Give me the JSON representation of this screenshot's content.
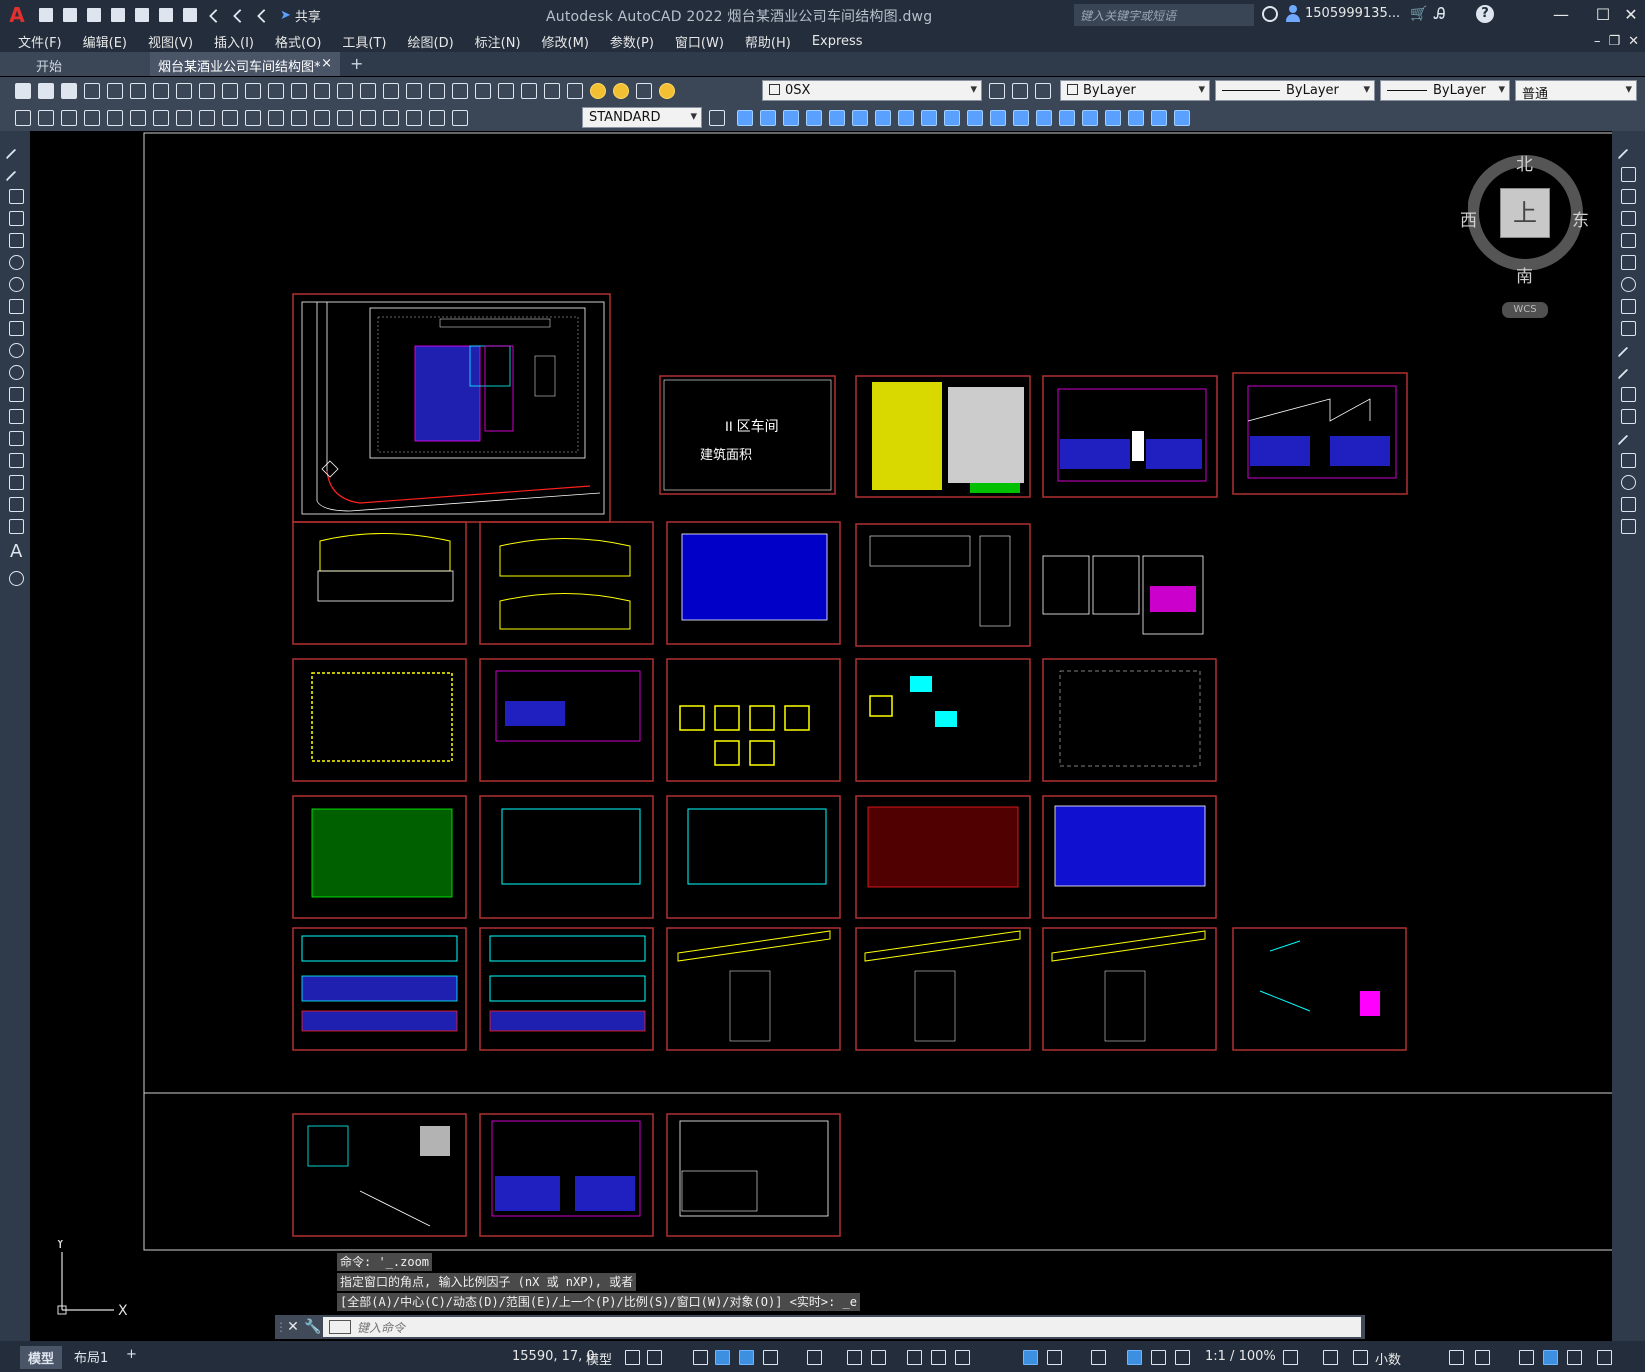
{
  "titlebar": {
    "title": "Autodesk AutoCAD 2022    烟台某酒业公司车间结构图.dwg",
    "share": "共享",
    "search_placeholder": "键入关键字或短语",
    "user": "1505999135...",
    "logo": "A"
  },
  "menu": [
    "文件(F)",
    "编辑(E)",
    "视图(V)",
    "插入(I)",
    "格式(O)",
    "工具(T)",
    "绘图(D)",
    "标注(N)",
    "修改(M)",
    "参数(P)",
    "窗口(W)",
    "帮助(H)",
    "Express"
  ],
  "tabs": {
    "start": "开始",
    "active": "烟台某酒业公司车间结构图*",
    "close": "×",
    "add": "+"
  },
  "toolbar": {
    "layer": "0SX",
    "text_style": "STANDARD",
    "color": "ByLayer",
    "linetype": "ByLayer",
    "lineweight": "ByLayer",
    "plot_style": "普通"
  },
  "canvas": {
    "sheet_title": "II 区车间",
    "sheet_subtitle": "建筑面积"
  },
  "compass": {
    "north": "北",
    "south": "南",
    "east": "东",
    "west": "西",
    "top": "上",
    "wcs": "WCS"
  },
  "ucs": {
    "y": "Y",
    "x": "X"
  },
  "command": {
    "history": [
      "命令: '_.zoom",
      "指定窗口的角点, 输入比例因子 (nX 或 nXP), 或者",
      "[全部(A)/中心(C)/动态(D)/范围(E)/上一个(P)/比例(S)/窗口(W)/对象(O)] <实时>: _e"
    ],
    "placeholder": "键入命令"
  },
  "status": {
    "model_tab": "模型",
    "layout_tab": "布局1",
    "add": "+",
    "coords": "15590, 17, 0",
    "space": "模型",
    "scale": "1:1 / 100%",
    "units": "小数"
  },
  "colors": {
    "sheet_border": "#b03030",
    "magenta": "#ff00ff",
    "yellow": "#ffff00",
    "cyan": "#00ffff",
    "blue": "#0000ff",
    "green": "#00ff00",
    "red": "#ff2020"
  }
}
